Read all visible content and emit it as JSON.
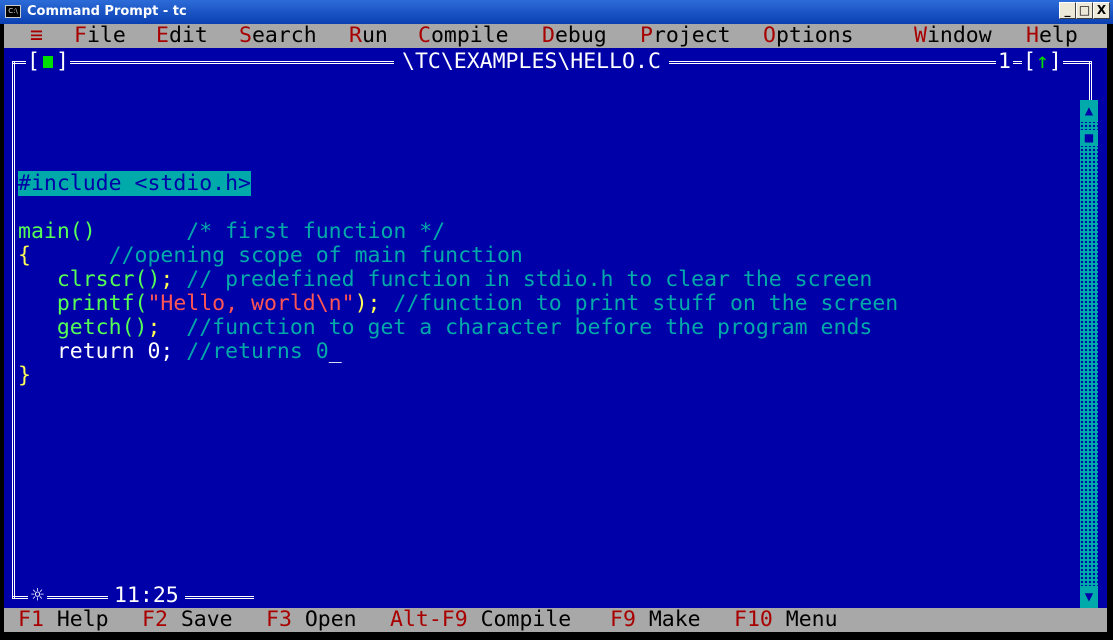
{
  "window": {
    "title": "Command Prompt - tc",
    "icon": "cmd-icon",
    "buttons": {
      "minimize": "_",
      "maximize": "□",
      "close": "X"
    }
  },
  "menu": [
    {
      "hotkey": "≡",
      "rest": ""
    },
    {
      "hotkey": "F",
      "rest": "ile"
    },
    {
      "hotkey": "E",
      "rest": "dit"
    },
    {
      "hotkey": "S",
      "rest": "earch"
    },
    {
      "hotkey": "R",
      "rest": "un"
    },
    {
      "hotkey": "C",
      "rest": "ompile"
    },
    {
      "hotkey": "D",
      "rest": "ebug"
    },
    {
      "hotkey": "P",
      "rest": "roject"
    },
    {
      "hotkey": "O",
      "rest": "ptions"
    },
    {
      "hotkey": "W",
      "rest": "indow"
    },
    {
      "hotkey": "H",
      "rest": "elp"
    }
  ],
  "editor": {
    "filename": "\\TC\\EXAMPLES\\HELLO.C",
    "window_number": "1",
    "zoom_arrow": "↑",
    "cursor_position": "11:25",
    "modified_marker": "☼",
    "code": {
      "include": "#include <stdio.h>",
      "main_decl": "main()",
      "main_comment": "/* first function */",
      "open_brace": "{",
      "open_comment": "//opening scope of main function",
      "clrscr": "clrscr()",
      "clrscr_semi": ";",
      "clrscr_comment": " // predefined function in stdio.h to clear the screen",
      "printf_name": "printf(",
      "printf_str": "\"Hello, world\\n\"",
      "printf_close": ");",
      "printf_comment": " //function to print stuff on the screen",
      "getch": "getch()",
      "getch_semi": ";",
      "getch_comment": "  //function to get a character before the program ends",
      "return_stmt": "return 0;",
      "return_comment": " //returns 0",
      "cursor": "_",
      "close_brace": "}"
    }
  },
  "statusbar": [
    {
      "key": "F1",
      "label": " Help"
    },
    {
      "key": "F2",
      "label": " Save"
    },
    {
      "key": "F3",
      "label": " Open"
    },
    {
      "key": "Alt-F9",
      "label": " Compile"
    },
    {
      "key": "F9",
      "label": " Make"
    },
    {
      "key": "F10",
      "label": " Menu"
    }
  ],
  "colors": {
    "editor_bg": "#0000a8",
    "menu_bg": "#a8a8a8",
    "hotkey": "#a80000"
  }
}
